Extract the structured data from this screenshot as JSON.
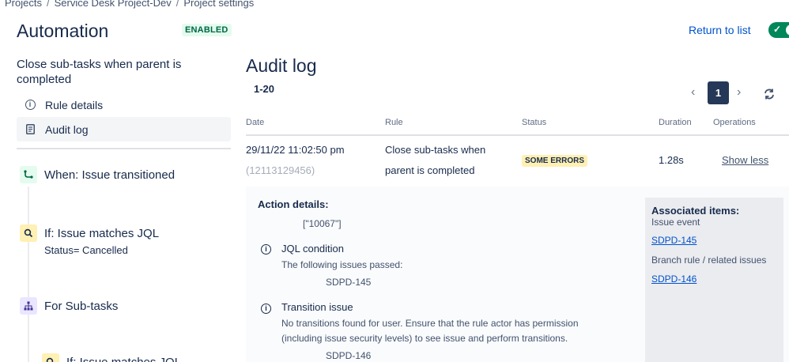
{
  "breadcrumb": [
    "Projects",
    "Service Desk Project-Dev",
    "Project settings"
  ],
  "header": {
    "title": "Automation",
    "enabled_badge": "ENABLED",
    "return_link": "Return to list",
    "toggle_state": "on"
  },
  "rule": {
    "name": "Close sub-tasks when parent is completed",
    "nav": [
      {
        "label": "Rule details",
        "icon": "info-icon"
      },
      {
        "label": "Audit log",
        "icon": "document-icon",
        "active": true
      }
    ],
    "components": [
      {
        "label": "When: Issue transitioned",
        "icon": "transition-icon",
        "type": "trigger"
      },
      {
        "label": "If: Issue matches JQL",
        "sub": "Status= Cancelled",
        "icon": "search-icon",
        "type": "condition"
      },
      {
        "label": "For Sub-tasks",
        "icon": "branch-icon",
        "type": "branch"
      },
      {
        "label": "If: Issue matches JQL",
        "icon": "search-icon",
        "type": "condition"
      }
    ]
  },
  "audit": {
    "title": "Audit log",
    "range": "1-20",
    "page": "1",
    "columns": [
      "Date",
      "Rule",
      "Status",
      "Duration",
      "Operations"
    ],
    "row": {
      "date": "29/11/22 11:02:50 pm",
      "id": "(12113129456)",
      "rule_line1": "Close sub-tasks when",
      "rule_line2": "parent is completed",
      "status": "SOME ERRORS",
      "duration": "1.28s",
      "operation": "Show less"
    },
    "details": {
      "heading": "Action details:",
      "value": "[\"10067\"]",
      "jql_title": "JQL condition",
      "jql_text": "The following issues passed:",
      "jql_issue": "SDPD-145",
      "transition_title": "Transition issue",
      "transition_text1": "No transitions found for user. Ensure that the rule actor has permission",
      "transition_text2": "(including issue security levels) to see issue and perform transitions.",
      "transition_issue": "SDPD-146"
    },
    "associated": {
      "heading": "Associated items:",
      "group1": "Issue event",
      "item1": "SDPD-145",
      "group2": "Branch rule / related issues",
      "item2": "SDPD-146"
    }
  },
  "colors": {
    "accent": "#0052CC",
    "toggle": "#00875A",
    "enabled_bg": "#E3FCEF",
    "warning_bg": "#FFF0B3",
    "page_selected": "#253858"
  }
}
